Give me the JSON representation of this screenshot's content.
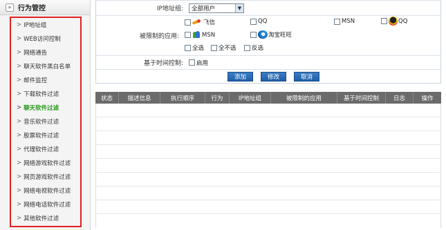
{
  "sidebar": {
    "collapse_icon": "»",
    "title": "行为管控",
    "items": [
      {
        "label": "IP地址组",
        "active": false
      },
      {
        "label": "WEB访问控制",
        "active": false
      },
      {
        "label": "网络通告",
        "active": false
      },
      {
        "label": "聊天软件黑白名单",
        "active": false
      },
      {
        "label": "邮件监控",
        "active": false
      },
      {
        "label": "下载软件过滤",
        "active": false
      },
      {
        "label": "聊天软件过滤",
        "active": true
      },
      {
        "label": "音乐软件过滤",
        "active": false
      },
      {
        "label": "股票软件过滤",
        "active": false
      },
      {
        "label": "代理软件过滤",
        "active": false
      },
      {
        "label": "网络游戏软件过滤",
        "active": false
      },
      {
        "label": "网页游戏软件过滤",
        "active": false
      },
      {
        "label": "网络电视软件过滤",
        "active": false
      },
      {
        "label": "网络电话软件过滤",
        "active": false
      },
      {
        "label": "其他软件过滤",
        "active": false
      }
    ]
  },
  "form": {
    "ip_group_label": "IP地址组:",
    "ip_group_value": "全部用户",
    "apps_label": "被限制的应用:",
    "apps": {
      "feixin": "飞信",
      "qq1": "QQ",
      "msn1": "MSN",
      "qq2": "QQ",
      "msn2": "MSN",
      "wangwang": "淘宝旺旺",
      "select_all": "全选",
      "select_none": "全不选",
      "invert": "反选"
    },
    "time_label": "基于时间控制:",
    "time_option": "启用"
  },
  "buttons": {
    "add": "添加",
    "modify": "修改",
    "cancel": "取消"
  },
  "table": {
    "headers": [
      "状态",
      "描述信息",
      "执行顺序",
      "行为",
      "IP地址组",
      "被限制的应用",
      "基于时间控制",
      "日志",
      "操作"
    ]
  },
  "colors": {
    "active_item": "#2a9a1e",
    "highlight_border": "#e02020",
    "button_blue": "#1e5fa8",
    "table_header": "#6b6b6b"
  }
}
